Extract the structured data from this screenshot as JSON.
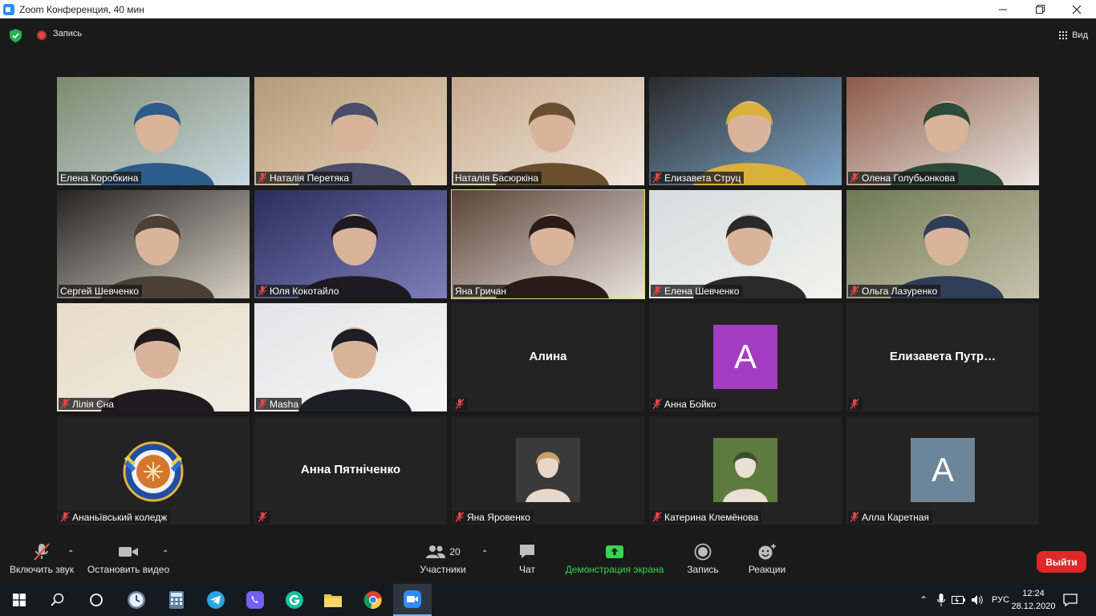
{
  "window": {
    "title": "Zoom Конференция, 40 мин"
  },
  "topbar": {
    "record_label": "Запись",
    "view_label": "Вид"
  },
  "tiles": [
    {
      "name": "Елена Коробкина",
      "muted": false,
      "kind": "video",
      "active": false,
      "colors": [
        "#7a8c6e",
        "#c9d8e0",
        "#2e5c8a"
      ]
    },
    {
      "name": "Наталія Перетяка",
      "muted": true,
      "kind": "video",
      "active": false,
      "colors": [
        "#b59a7a",
        "#e6d2b8",
        "#4b4e6a"
      ]
    },
    {
      "name": "Наталія Басюркіна",
      "muted": false,
      "kind": "video",
      "active": false,
      "colors": [
        "#c7a98c",
        "#efe6dc",
        "#6b4e2e"
      ]
    },
    {
      "name": "Елизавета Струц",
      "muted": true,
      "kind": "video",
      "active": false,
      "colors": [
        "#2a2a2a",
        "#7fa6c9",
        "#d8b13a"
      ]
    },
    {
      "name": "Олена Голубьонкова",
      "muted": true,
      "kind": "video",
      "active": false,
      "colors": [
        "#8d5a48",
        "#eae6e0",
        "#2c4a3a"
      ]
    },
    {
      "name": "Сергей Шевченко",
      "muted": false,
      "kind": "video",
      "active": false,
      "colors": [
        "#232323",
        "#d8d0c2",
        "#4a4034"
      ]
    },
    {
      "name": "Юля Кокотайло",
      "muted": true,
      "kind": "video",
      "active": false,
      "colors": [
        "#2b2c5e",
        "#7e7fb8",
        "#1d1a22"
      ]
    },
    {
      "name": "Яна Гричан",
      "muted": false,
      "kind": "video",
      "active": true,
      "colors": [
        "#5a4236",
        "#e9e3dc",
        "#2a1c18"
      ]
    },
    {
      "name": "Елена Шевченко",
      "muted": true,
      "kind": "video",
      "active": false,
      "colors": [
        "#d8dcdc",
        "#f2f2f0",
        "#2a2a2a"
      ]
    },
    {
      "name": "Ольга Лазуренко",
      "muted": true,
      "kind": "video",
      "active": false,
      "colors": [
        "#6f7a52",
        "#c9c2ae",
        "#2e3d58"
      ]
    },
    {
      "name": "Лілія Єна",
      "muted": true,
      "kind": "video",
      "active": false,
      "colors": [
        "#e7dcc6",
        "#f0ece2",
        "#1e1a1e"
      ]
    },
    {
      "name": "Masha",
      "muted": true,
      "kind": "video",
      "active": false,
      "colors": [
        "#e4e4e6",
        "#f6f6f6",
        "#1e1e26"
      ]
    },
    {
      "name": "",
      "display_name": "Алина",
      "muted": true,
      "kind": "name",
      "active": false
    },
    {
      "name": "Анна Бойко",
      "muted": true,
      "kind": "letter",
      "letter": "A",
      "avatar_color": "#a43bc3",
      "active": false
    },
    {
      "name": "",
      "display_name": "Елизавета Путр…",
      "muted": true,
      "kind": "name",
      "active": false
    },
    {
      "name": "Ананьївський коледж",
      "muted": true,
      "kind": "logo",
      "active": false
    },
    {
      "name": "",
      "display_name": "Анна Пятніченко",
      "muted": true,
      "kind": "name",
      "active": false
    },
    {
      "name": "Яна Яровенко",
      "muted": true,
      "kind": "photo",
      "active": false,
      "colors": [
        "#3a3a3a",
        "#e8d6c8",
        "#c7a26e"
      ]
    },
    {
      "name": "Катерина Клемёнова",
      "muted": true,
      "kind": "photo",
      "active": false,
      "colors": [
        "#5e7a3e",
        "#e8e0d2",
        "#3b4e2a"
      ]
    },
    {
      "name": "Алла Каретная",
      "muted": true,
      "kind": "letter",
      "letter": "A",
      "avatar_color": "#6d8599",
      "active": false
    }
  ],
  "toolbar": {
    "unmute_label": "Включить звук",
    "video_label": "Остановить видео",
    "participants_label": "Участники",
    "participants_count": "20",
    "chat_label": "Чат",
    "share_label": "Демонстрация экрана",
    "record_label": "Запись",
    "reactions_label": "Реакции",
    "leave_label": "Выйти"
  },
  "taskbar": {
    "lang": "РУС",
    "time": "12:24",
    "date": "28.12.2020"
  },
  "colors": {
    "accent_green": "#39d353",
    "leave_red": "#e02828",
    "active_speaker": "#e0e55a",
    "mute_red": "#e64646"
  }
}
